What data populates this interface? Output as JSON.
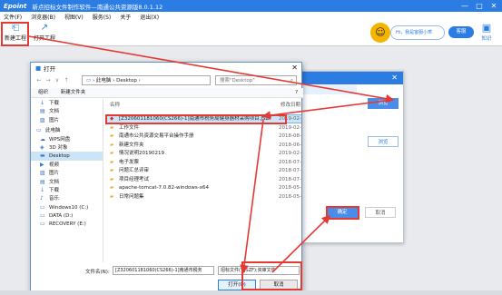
{
  "app": {
    "logo": "Epoint",
    "title": "新点招标文件制作软件—南通公共资源版8.0.1.12",
    "minimize": "—",
    "restore": "□",
    "close": "✕"
  },
  "menu": [
    "文件(F)",
    "浏览器(B)",
    "视图(V)",
    "服务(S)",
    "关于",
    "退出(X)"
  ],
  "toolbar": {
    "new_project": "新建工程",
    "open_project": "打开工程",
    "hi_bubble": "Hi，我是客服小乖",
    "service_pill": "客服",
    "kb_label": "知识"
  },
  "bg_dialog": {
    "close": "✕",
    "browse1": "浏览",
    "browse2": "浏览",
    "ok": "确定",
    "cancel": "取消"
  },
  "file_dialog": {
    "title": "打开",
    "close": "✕",
    "path_parts": [
      "此电脑",
      "Desktop"
    ],
    "search_placeholder": "搜索\"Desktop\"",
    "organize": "组织",
    "new_folder": "新建文件夹",
    "sidebar": [
      {
        "icon": "download-icon",
        "label": "下载"
      },
      {
        "icon": "document-icon",
        "label": "文档"
      },
      {
        "icon": "picture-icon",
        "label": "图片"
      },
      {
        "icon": "pc-icon",
        "label": "此电脑"
      },
      {
        "icon": "cloud-icon",
        "label": "WPS网盘"
      },
      {
        "icon": "cube-icon",
        "label": "3D 对象"
      },
      {
        "icon": "desktop-icon",
        "label": "Desktop"
      },
      {
        "icon": "video-icon",
        "label": "视频"
      },
      {
        "icon": "picture-icon",
        "label": "图片"
      },
      {
        "icon": "document-icon",
        "label": "文档"
      },
      {
        "icon": "download-icon",
        "label": "下载"
      },
      {
        "icon": "music-icon",
        "label": "音乐"
      },
      {
        "icon": "drive-icon",
        "label": "Windows10 (C:)"
      },
      {
        "icon": "drive-icon",
        "label": "DATA (D:)"
      },
      {
        "icon": "drive-icon",
        "label": "RECOVERY (E:)"
      }
    ],
    "columns": {
      "name": "名称",
      "date": "修改日期"
    },
    "files": [
      {
        "icon": "special-file-icon",
        "name": "[Z320601181060(CS266)-1]南通市税务局健身器材采购项目.JSZF",
        "date": "2019-02-"
      },
      {
        "icon": "folder-icon",
        "name": "工作文件",
        "date": "2019-02-"
      },
      {
        "icon": "folder-icon",
        "name": "南通市公共资源交易平台操作手册",
        "date": "2018-08-"
      },
      {
        "icon": "folder-icon",
        "name": "新建文件夹",
        "date": "2018-06-"
      },
      {
        "icon": "folder-icon",
        "name": "情况说明20190219",
        "date": "2019-02-"
      },
      {
        "icon": "folder-icon",
        "name": "电子发票",
        "date": "2018-07-"
      },
      {
        "icon": "folder-icon",
        "name": "问题汇总评审",
        "date": "2018-07-"
      },
      {
        "icon": "folder-icon",
        "name": "项目经理考试",
        "date": "2018-07-"
      },
      {
        "icon": "folder-icon",
        "name": "apache-tomcat-7.0.82-windows-x64",
        "date": "2018-05-"
      },
      {
        "icon": "folder-icon",
        "name": "日常问题集",
        "date": "2018-05-"
      }
    ],
    "filename_label": "文件名(N):",
    "filename_value": "[Z320601181060(CS266)-1]南通市税务",
    "filetype_value": "招标文件(*.JSZF);资审文件",
    "open": "打开(O)",
    "cancel": "取消"
  },
  "colors": {
    "accent": "#2b7de4",
    "annotation": "#e53935"
  }
}
